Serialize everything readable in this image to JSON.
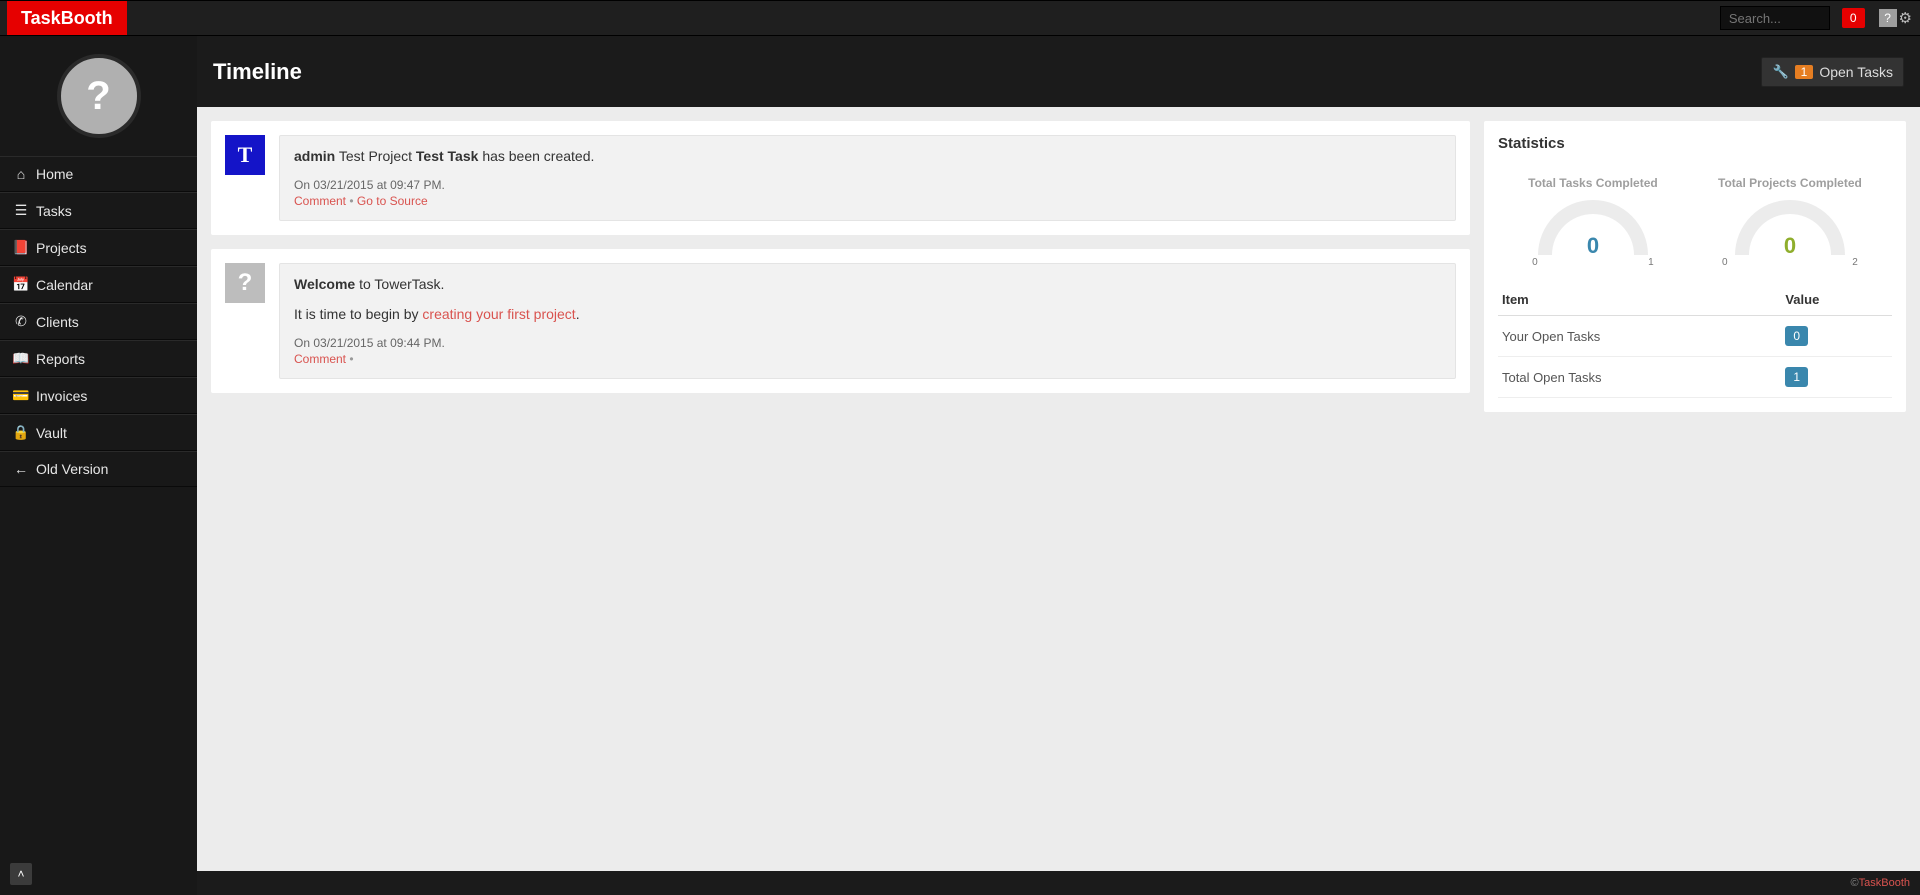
{
  "brand": "TaskBooth",
  "search": {
    "placeholder": "Search..."
  },
  "notifications": "0",
  "page_title": "Timeline",
  "open_tasks_button": {
    "count": "1",
    "label": "Open Tasks"
  },
  "sidebar": {
    "items": [
      {
        "icon": "home-icon",
        "glyph": "⌂",
        "label": "Home"
      },
      {
        "icon": "tasks-icon",
        "glyph": "☰",
        "label": "Tasks"
      },
      {
        "icon": "projects-icon",
        "glyph": "📕",
        "label": "Projects"
      },
      {
        "icon": "calendar-icon",
        "glyph": "📅",
        "label": "Calendar"
      },
      {
        "icon": "clients-icon",
        "glyph": "✆",
        "label": "Clients"
      },
      {
        "icon": "reports-icon",
        "glyph": "📖",
        "label": "Reports"
      },
      {
        "icon": "invoices-icon",
        "glyph": "💳",
        "label": "Invoices"
      },
      {
        "icon": "vault-icon",
        "glyph": "🔒",
        "label": "Vault"
      },
      {
        "icon": "old-version-icon",
        "glyph": "←",
        "label": "Old Version"
      }
    ]
  },
  "feed": [
    {
      "avatar": "T",
      "avatar_style": "blue",
      "user": "admin",
      "project": "Test Project",
      "task": "Test Task",
      "suffix": "has been created.",
      "timestamp": "On 03/21/2015 at 09:47 PM.",
      "comment_label": "Comment",
      "source_label": "Go to Source"
    },
    {
      "avatar": "?",
      "avatar_style": "gray",
      "welcome_bold": "Welcome",
      "welcome_rest": "to TowerTask.",
      "body_prefix": "It is time to begin by ",
      "body_link": "creating your first project",
      "body_suffix": ".",
      "timestamp": "On 03/21/2015 at 09:44 PM.",
      "comment_label": "Comment"
    }
  ],
  "stats": {
    "title": "Statistics",
    "gauges": [
      {
        "title": "Total Tasks Completed",
        "value": "0",
        "style": "blue",
        "min": "0",
        "max": "1"
      },
      {
        "title": "Total Projects Completed",
        "value": "0",
        "style": "green",
        "min": "0",
        "max": "2"
      }
    ],
    "table": {
      "headers": [
        "Item",
        "Value"
      ],
      "rows": [
        {
          "item": "Your Open Tasks",
          "value": "0"
        },
        {
          "item": "Total Open Tasks",
          "value": "1"
        }
      ]
    }
  },
  "footer": {
    "copyright": "© ",
    "brand": "TaskBooth"
  }
}
